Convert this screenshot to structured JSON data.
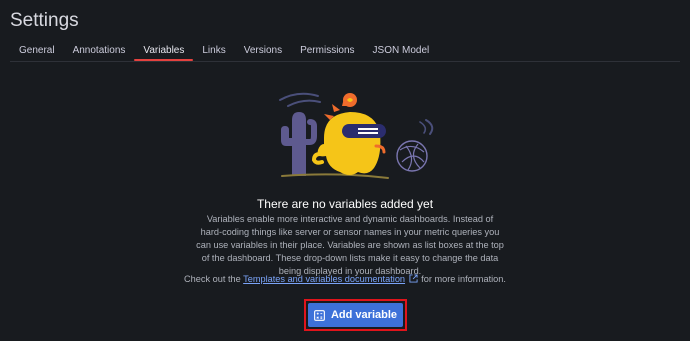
{
  "page": {
    "title": "Settings"
  },
  "tabs": [
    {
      "label": "General"
    },
    {
      "label": "Annotations"
    },
    {
      "label": "Variables",
      "active": true
    },
    {
      "label": "Links"
    },
    {
      "label": "Versions"
    },
    {
      "label": "Permissions"
    },
    {
      "label": "JSON Model"
    }
  ],
  "empty_state": {
    "heading": "There are no variables added yet",
    "description": "Variables enable more interactive and dynamic dashboards. Instead of hard-coding things like server or sensor names in your metric queries you can use variables in their place. Variables are shown as list boxes at the top of the dashboard. These drop-down lists make it easy to change the data being displayed in your dashboard.",
    "checkout_prefix": "Check out the",
    "doc_link": "Templates and variables documentation",
    "checkout_suffix": "for more information.",
    "add_button": "Add variable",
    "illustration_icon": "dinosaur-illustration"
  },
  "colors": {
    "background": "#181b1f",
    "active_tab_underline": "#e5423f",
    "primary_button": "#3d71d9",
    "link": "#7aa3f7",
    "highlight_border": "#e0141b"
  }
}
